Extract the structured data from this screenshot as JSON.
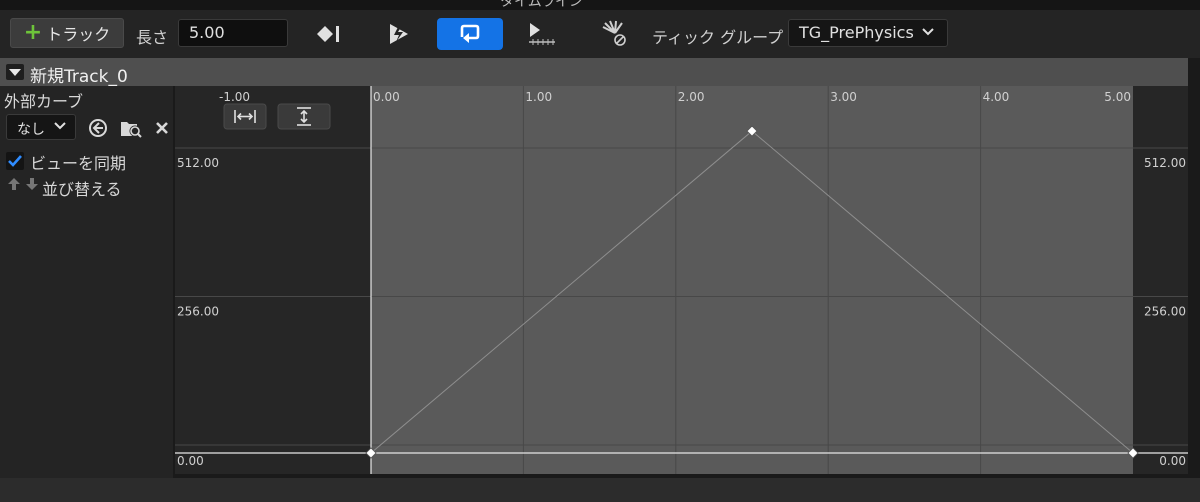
{
  "window": {
    "title": "タイムライン"
  },
  "toolbar": {
    "add_track_label": "トラック",
    "length_label": "長さ",
    "length_value": "5.00",
    "tick_group_label": "ティック グループ",
    "tick_group_value": "TG_PrePhysics",
    "icons": {
      "add": "plus-icon",
      "add_key": "add-key-icon",
      "autoplay": "autoplay-icon",
      "loop": "loop-icon",
      "last_keyframe": "last-keyframe-icon",
      "replicated": "replicated-icon"
    },
    "loop_active_color": "#1473e6"
  },
  "track": {
    "name": "新規Track_0"
  },
  "left_panel": {
    "external_curve_label": "外部カーブ",
    "curve_combo_value": "なし",
    "sync_view_label": "ビューを同期",
    "sync_view_checked": true,
    "reorder_label": "並び替える"
  },
  "graph": {
    "top_buttons": [
      "fit-horizontal-icon",
      "fit-vertical-icon"
    ]
  },
  "chart_data": {
    "type": "line",
    "x_ticks": [
      "-1.00",
      "0.00",
      "1.00",
      "2.00",
      "3.00",
      "4.00",
      "5.00"
    ],
    "y_ticks_left": [
      "512.00",
      "256.00",
      "0.00"
    ],
    "y_ticks_right": [
      "512.00",
      "256.00",
      "0.00"
    ],
    "xlim": [
      -1.0,
      5.0
    ],
    "ylim": [
      0,
      512
    ],
    "timeline_range": [
      0.0,
      5.0
    ],
    "series": [
      {
        "x": [
          0.0,
          2.5,
          5.0
        ],
        "y": [
          0,
          555,
          0
        ]
      }
    ],
    "grid": true
  }
}
